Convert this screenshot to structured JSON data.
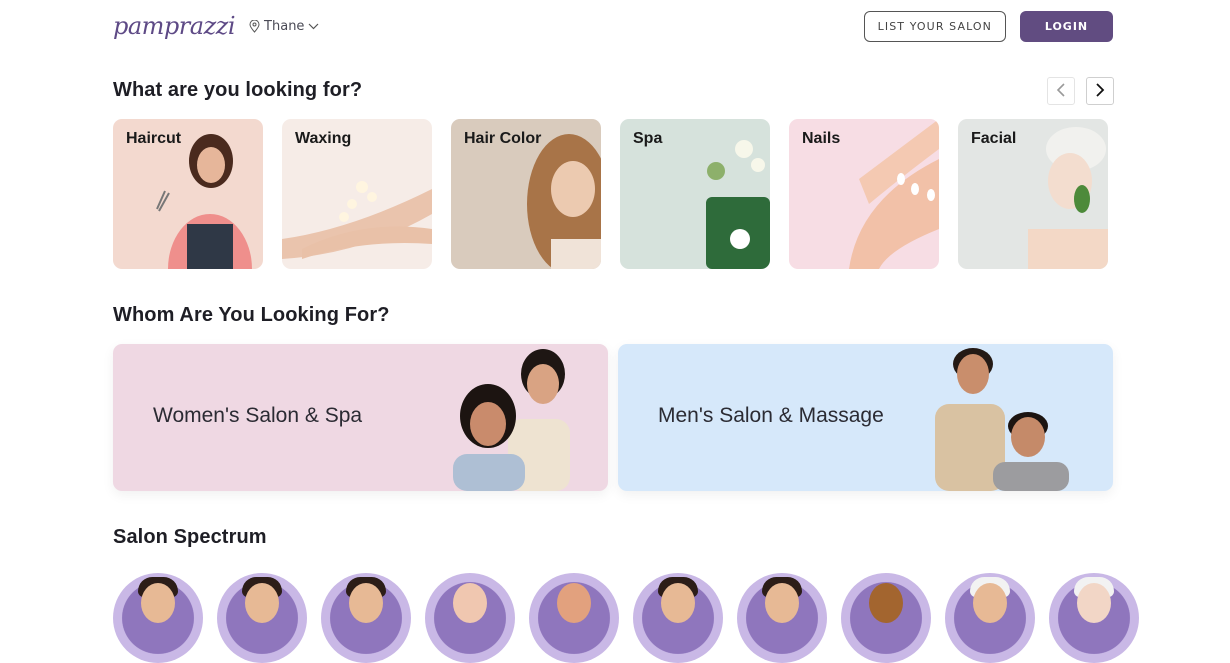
{
  "header": {
    "logo": "pamprazzi",
    "location": "Thane",
    "list_salon_label": "LIST YOUR SALON",
    "login_label": "LOGIN"
  },
  "sections": {
    "categories_title": "What are you looking for?",
    "audience_title": "Whom Are You Looking For?",
    "spectrum_title": "Salon Spectrum"
  },
  "categories": [
    {
      "label": "Haircut",
      "bg": "#f3d9cf"
    },
    {
      "label": "Waxing",
      "bg": "#f6ece7"
    },
    {
      "label": "Hair Color",
      "bg": "#d9cbbd"
    },
    {
      "label": "Spa",
      "bg": "#d6e2dc"
    },
    {
      "label": "Nails",
      "bg": "#f7dde4"
    },
    {
      "label": "Facial",
      "bg": "#e3e6e4"
    }
  ],
  "audience": [
    {
      "label": "Women's Salon & Spa",
      "bg": "#efd8e3"
    },
    {
      "label": "Men's Salon & Massage",
      "bg": "#d6e8fa"
    }
  ],
  "spectrum_count": 10,
  "colors": {
    "brand": "#614c81",
    "logo": "#5e4a86"
  }
}
